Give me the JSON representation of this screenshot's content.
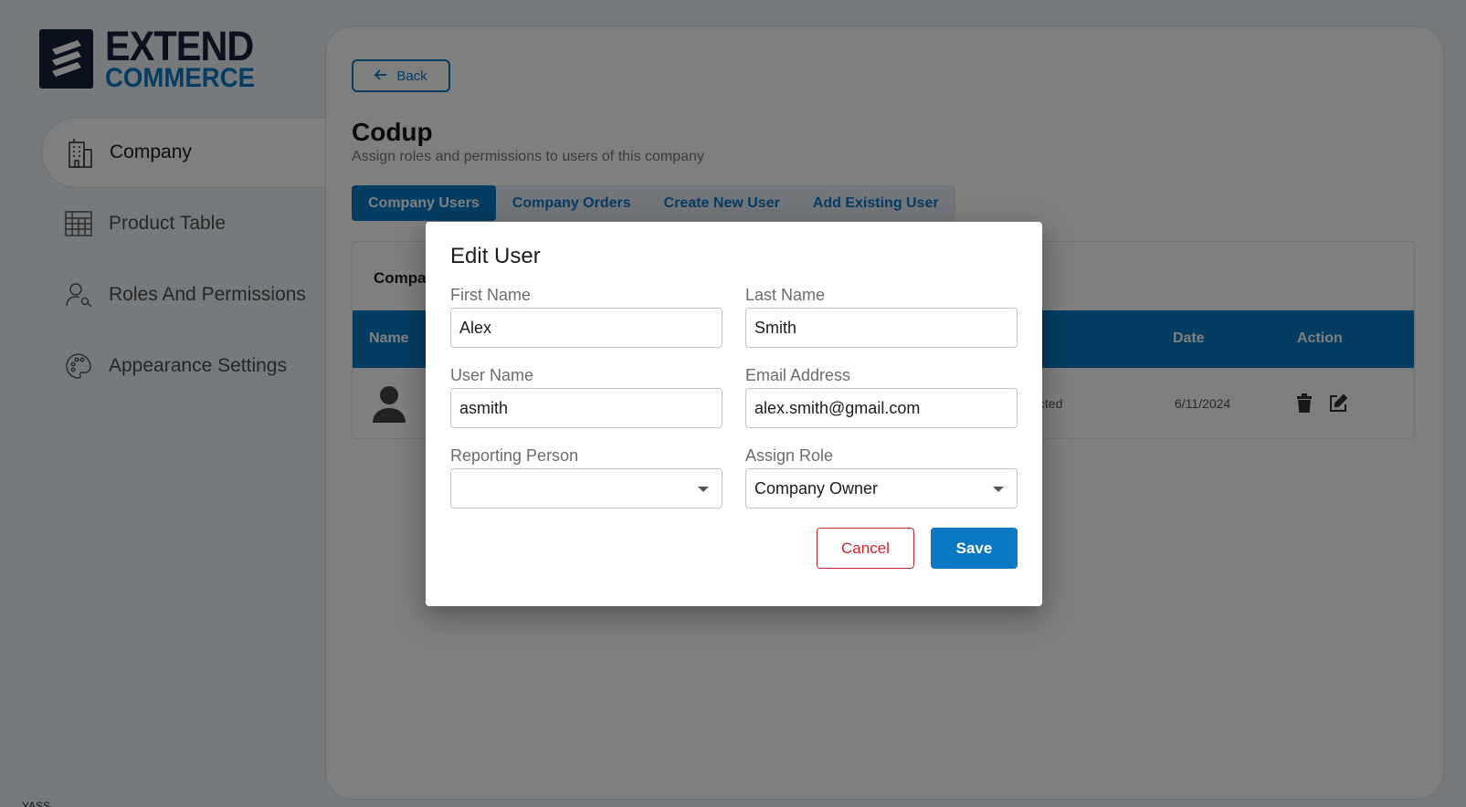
{
  "brand": {
    "line1": "EXTEND",
    "line2": "COMMERCE"
  },
  "sidebar": {
    "items": [
      {
        "label": "Company",
        "icon": "building-icon",
        "active": true
      },
      {
        "label": "Product Table",
        "icon": "table-icon",
        "active": false
      },
      {
        "label": "Roles And Permissions",
        "icon": "user-key-icon",
        "active": false
      },
      {
        "label": "Appearance Settings",
        "icon": "palette-icon",
        "active": false
      }
    ]
  },
  "main": {
    "back_label": "Back",
    "title": "Codup",
    "subtitle": "Assign roles and permissions to users of this company",
    "tabs": [
      {
        "label": "Company Users",
        "active": true
      },
      {
        "label": "Company Orders",
        "active": false
      },
      {
        "label": "Create New User",
        "active": false
      },
      {
        "label": "Add Existing User",
        "active": false
      }
    ],
    "card_title": "Compa",
    "table": {
      "headers": {
        "name": "Name",
        "date": "Date",
        "action": "Action"
      },
      "rows": [
        {
          "status": "lected",
          "date": "6/11/2024"
        }
      ]
    }
  },
  "modal": {
    "title": "Edit User",
    "fields": {
      "first_name": {
        "label": "First Name",
        "value": "Alex"
      },
      "last_name": {
        "label": "Last Name",
        "value": "Smith"
      },
      "user_name": {
        "label": "User Name",
        "value": "asmith"
      },
      "email": {
        "label": "Email Address",
        "value": "alex.smith@gmail.com"
      },
      "reporting_person": {
        "label": "Reporting Person",
        "value": ""
      },
      "assign_role": {
        "label": "Assign Role",
        "value": "Company Owner"
      }
    },
    "cancel_label": "Cancel",
    "save_label": "Save"
  },
  "footer_text": "YASS",
  "colors": {
    "accent": "#0b78c4",
    "brand_dark": "#14213a",
    "danger": "#c62828"
  }
}
